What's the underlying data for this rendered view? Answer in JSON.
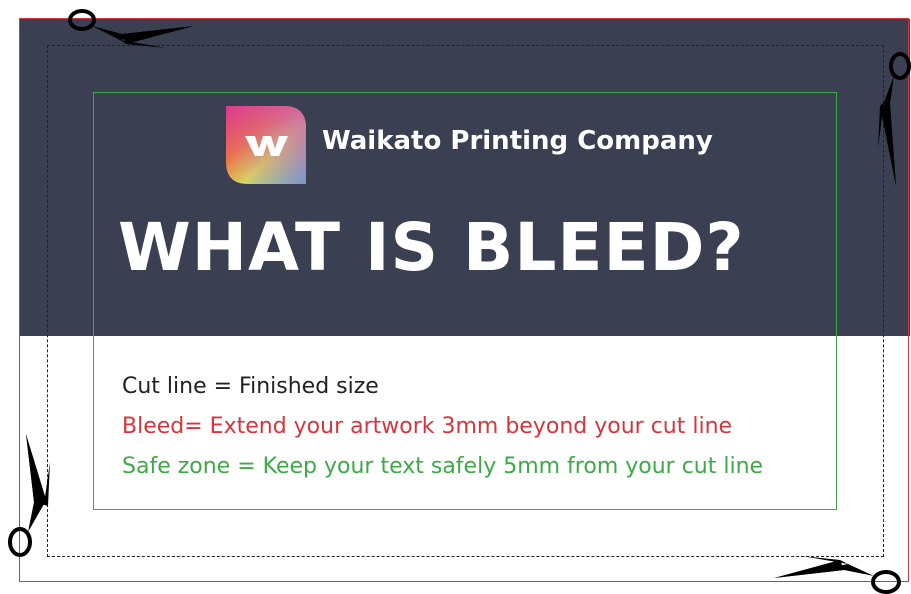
{
  "brand": {
    "name": "Waikato Printing Company",
    "logo_letter": "W"
  },
  "headline": "WHAT IS BLEED?",
  "legend": {
    "cut": "Cut line = Finished size",
    "bleed": "Bleed= Extend your artwork 3mm beyond your cut line",
    "safe": "Safe zone = Keep your text safely 5mm from your cut line"
  },
  "colors": {
    "background_band": "#3b3f52",
    "bleed_line": "#d9343b",
    "cut_line": "#222222",
    "safe_line": "#3daa47",
    "text_light": "#ffffff"
  },
  "icons": [
    "scissors-icon",
    "scissors-icon",
    "scissors-icon",
    "scissors-icon",
    "waikato-logo-icon"
  ]
}
